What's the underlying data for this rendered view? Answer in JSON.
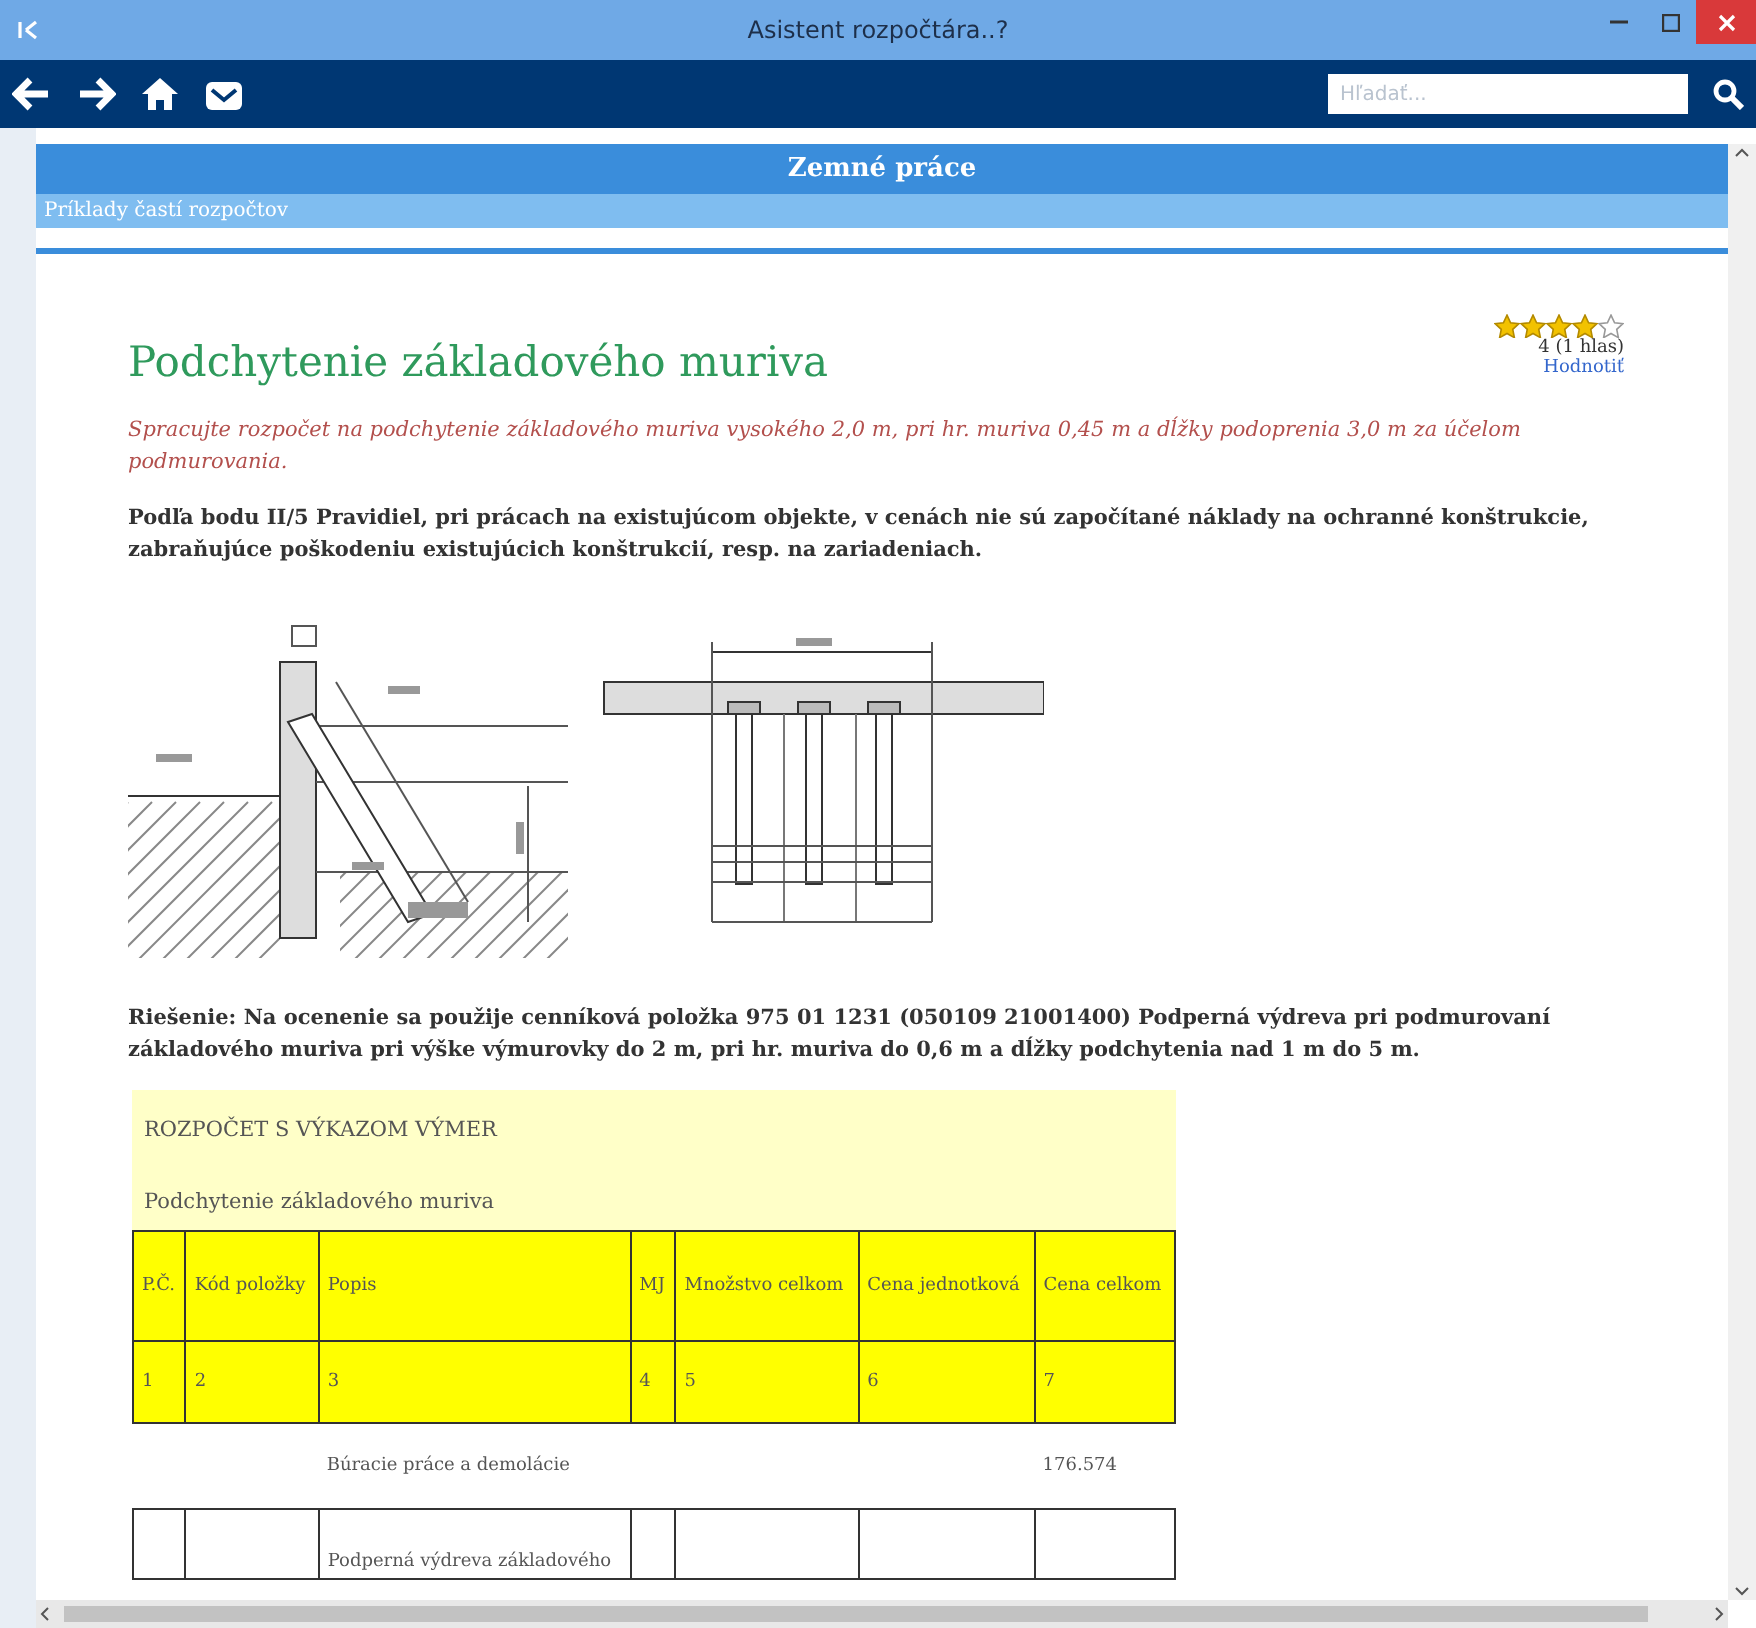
{
  "window": {
    "title": "Asistent rozpočtára..?"
  },
  "toolbar": {
    "search": {
      "placeholder": "Hľadať..."
    }
  },
  "section": {
    "title": "Zemné práce",
    "subtitle": "Príklady častí rozpočtov"
  },
  "article": {
    "title": "Podchytenie základového muriva",
    "rating": {
      "stars": 4,
      "count": "4 (1 hlas)",
      "link": "Hodnotiť"
    },
    "task": "Spracujte rozpočet na podchytenie základového muriva vysokého 2,0 m, pri hr. muriva 0,45 m a dĺžky podoprenia 3,0 m za účelom podmurovania.",
    "note": "Podľa bodu II/5 Pravidiel, pri prácach na existujúcom objekte, v cenách nie sú započítané náklady na ochranné konštrukcie, zabraňujúce poškodeniu existujúcich konštrukcií, resp. na zariadeniach.",
    "solution": "Riešenie: Na ocenenie sa použije cenníková položka 975 01 1231 (050109 21001400) Podperná výdreva pri podmurovaní základového muriva pri výške výmurovky do 2 m, pri hr. muriva do 0,6 m a dĺžky podchytenia nad 1 m do 5 m.",
    "budget": {
      "heading": "ROZPOČET S VÝKAZOM VÝMER",
      "subheading": "Podchytenie základového muriva",
      "columns": [
        "P.Č.",
        "Kód položky",
        "Popis",
        "MJ",
        "Množstvo celkom",
        "Cena jednotková",
        "Cena celkom"
      ],
      "numbers": [
        "1",
        "2",
        "3",
        "4",
        "5",
        "6",
        "7"
      ],
      "group": {
        "name": "Búracie práce a demolácie",
        "total": "176.574"
      },
      "rows": [
        [
          "",
          "",
          "Podperná výdreva základového",
          "",
          "",
          "",
          ""
        ]
      ]
    }
  }
}
